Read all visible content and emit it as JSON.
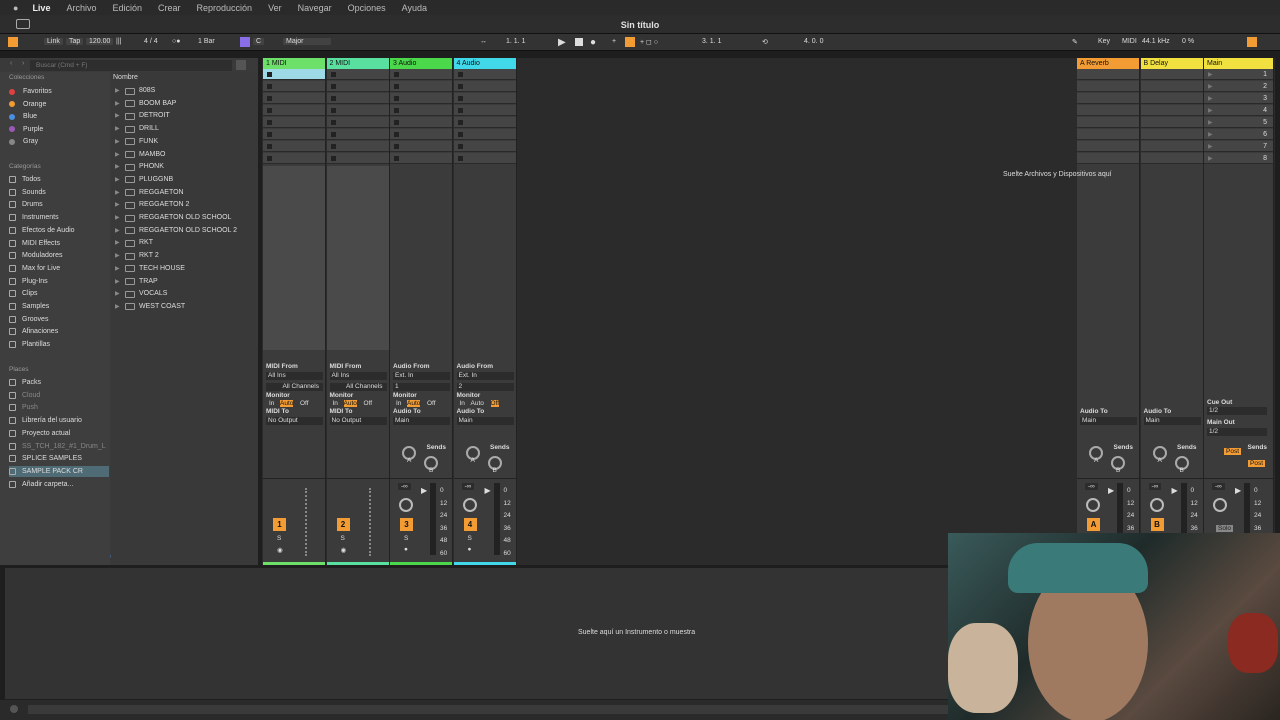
{
  "menu": [
    "Live",
    "Archivo",
    "Edición",
    "Crear",
    "Reproducción",
    "Ver",
    "Navegar",
    "Opciones",
    "Ayuda"
  ],
  "window_title": "Sin título",
  "toolbar": {
    "link": "Link",
    "tap": "Tap",
    "tempo": "120.00",
    "meter": "4 / 4",
    "quant": "1 Bar",
    "key": "C",
    "scale": "Major",
    "pos": "1.   1.   1",
    "loop_start": "3.   1.   1",
    "loop_len": "4.   0.   0",
    "key_btn": "Key",
    "midi_btn": "MIDI",
    "sample_rate": "44.1 kHz",
    "cpu": "0 %"
  },
  "browser": {
    "search_placeholder": "Buscar (Cmd + F)",
    "colecciones_header": "Colecciones",
    "collections": [
      {
        "label": "Favoritos",
        "color": "#e04040"
      },
      {
        "label": "Orange",
        "color": "#f39c34"
      },
      {
        "label": "Blue",
        "color": "#4a90e2"
      },
      {
        "label": "Purple",
        "color": "#9b59b6"
      },
      {
        "label": "Gray",
        "color": "#888888"
      }
    ],
    "categorias_header": "Categorías",
    "categories": [
      "Todos",
      "Sounds",
      "Drums",
      "Instruments",
      "Efectos de Audio",
      "MIDI Effects",
      "Moduladores",
      "Max for Live",
      "Plug-Ins",
      "Clips",
      "Samples",
      "Grooves",
      "Afinaciones",
      "Plantillas"
    ],
    "places_header": "Places",
    "places": [
      "Packs",
      "Cloud",
      "Push",
      "Librería del usuario",
      "Proyecto actual",
      "SS_TCH_182_#1_Drum_L",
      "SPLICE SAMPLES",
      "SAMPLE PACK CR",
      "Añadir carpeta..."
    ],
    "name_header": "Nombre",
    "folders": [
      "808S",
      "BOOM BAP",
      "DETROIT",
      "DRILL",
      "FUNK",
      "MAMBO",
      "PHONK",
      "PLUGGNB",
      "REGGAETON",
      "REGGAETON 2",
      "REGGAETON OLD SCHOOL",
      "REGGAETON OLD SCHOOL 2",
      "RKT",
      "RKT 2",
      "TECH HOUSE",
      "TRAP",
      "VOCALS",
      "WEST COAST"
    ]
  },
  "tracks": [
    {
      "name": "1 MIDI",
      "color": "#6de06a",
      "from_label": "MIDI From",
      "from": "All Ins",
      "ch": "All Channels",
      "num": "1",
      "to": "No Output",
      "to_label": "MIDI To"
    },
    {
      "name": "2 MIDI",
      "color": "#59e0a0",
      "from_label": "MIDI From",
      "from": "All Ins",
      "ch": "All Channels",
      "num": "2",
      "to": "No Output",
      "to_label": "MIDI To"
    },
    {
      "name": "3 Audio",
      "color": "#4bd84b",
      "from_label": "Audio From",
      "from": "Ext. In",
      "ch": "1",
      "num": "3",
      "to": "Main",
      "to_label": "Audio To"
    },
    {
      "name": "4 Audio",
      "color": "#41d8ea",
      "from_label": "Audio From",
      "from": "Ext. In",
      "ch": "2",
      "num": "4",
      "to": "Main",
      "to_label": "Audio To"
    }
  ],
  "returns": [
    {
      "name": "A Reverb",
      "color": "#f39c34",
      "num": "A",
      "to": "Main",
      "to_label": "Audio To"
    },
    {
      "name": "B Delay",
      "color": "#f0e040",
      "num": "B",
      "to": "Main",
      "to_label": "Audio To"
    }
  ],
  "main": {
    "name": "Main",
    "color": "#f0e040",
    "cue_label": "Cue Out",
    "cue": "1/2",
    "out_label": "Main Out",
    "out": "1/2",
    "solo": "Solo",
    "post": "Post"
  },
  "scenes": [
    "1",
    "2",
    "3",
    "4",
    "5",
    "6",
    "7",
    "8"
  ],
  "monitor": {
    "label": "Monitor",
    "in": "In",
    "auto": "Auto",
    "off": "Off"
  },
  "sends_label": "Sends",
  "s_label": "S",
  "ab": [
    "A",
    "B"
  ],
  "vol_value": "-∞",
  "db_ticks": [
    "0",
    "12",
    "24",
    "36",
    "48",
    "60"
  ],
  "drop_files": "Suelte Archivos y Dispositivos aquí",
  "drop_instrument": "Suelte aquí un Instrumento o muestra"
}
